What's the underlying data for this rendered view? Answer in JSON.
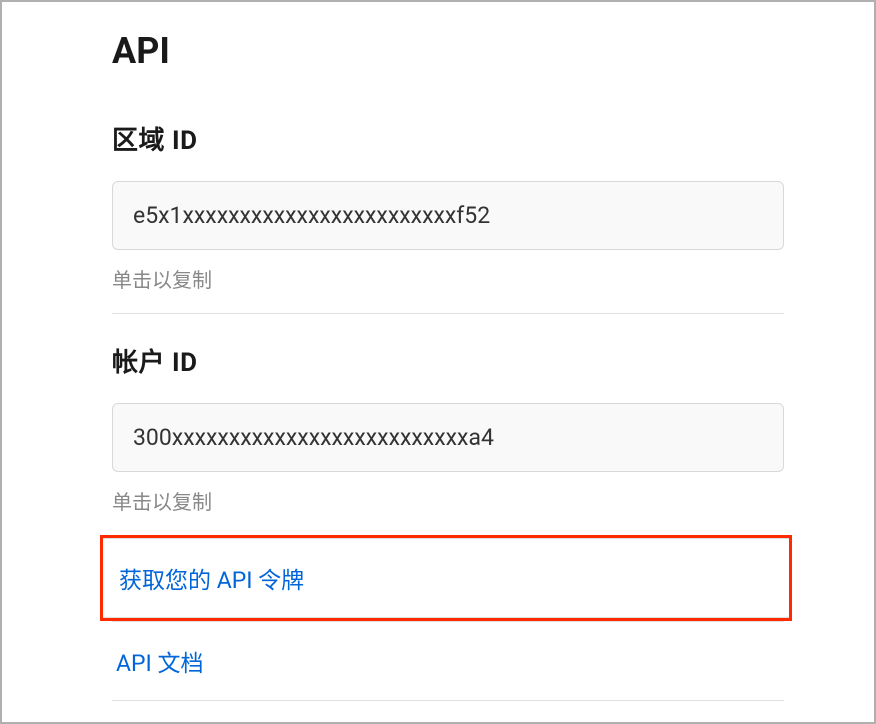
{
  "page": {
    "title": "API"
  },
  "zone": {
    "label": "区域 ID",
    "value": "e5x1xxxxxxxxxxxxxxxxxxxxxxxxf52",
    "hint": "单击以复制"
  },
  "account": {
    "label": "帐户 ID",
    "value": "300xxxxxxxxxxxxxxxxxxxxxxxxxxa4",
    "hint": "单击以复制"
  },
  "links": {
    "get_token": "获取您的 API 令牌",
    "api_docs": "API 文档"
  }
}
